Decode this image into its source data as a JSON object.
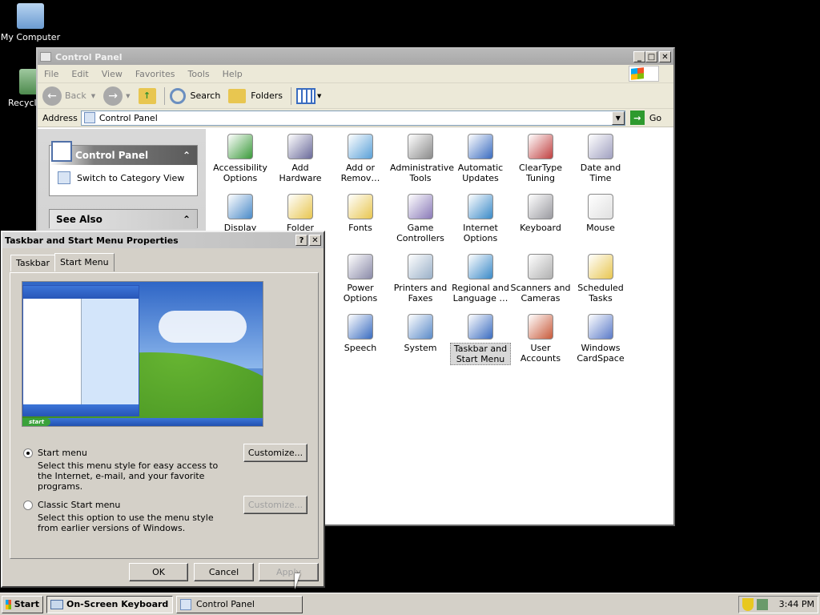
{
  "desktop": {
    "icons": [
      {
        "label": "My Computer",
        "icon": "computer-icon"
      },
      {
        "label": "Recycl",
        "icon": "recycle-bin-icon"
      }
    ]
  },
  "control_panel": {
    "title": "Control Panel",
    "menu": [
      "File",
      "Edit",
      "View",
      "Favorites",
      "Tools",
      "Help"
    ],
    "toolbar": {
      "back": "Back",
      "search": "Search",
      "folders": "Folders"
    },
    "address": {
      "label": "Address",
      "value": "Control Panel",
      "go": "Go"
    },
    "left_pane": {
      "box_title": "Control Panel",
      "switch_link": "Switch to Category View",
      "see_also": "See Also"
    },
    "items": [
      {
        "label": "Accessibility Options",
        "icon": "accessibility-icon"
      },
      {
        "label": "Add Hardware",
        "icon": "add-hardware-icon"
      },
      {
        "label": "Add or Remov…",
        "icon": "add-remove-programs-icon"
      },
      {
        "label": "Administrative Tools",
        "icon": "admin-tools-icon"
      },
      {
        "label": "Automatic Updates",
        "icon": "automatic-updates-icon"
      },
      {
        "label": "ClearType Tuning",
        "icon": "cleartype-icon"
      },
      {
        "label": "Date and Time",
        "icon": "date-time-icon"
      },
      {
        "label": "Display",
        "icon": "display-icon"
      },
      {
        "label": "Folder Options",
        "icon": "folder-options-icon"
      },
      {
        "label": "Fonts",
        "icon": "fonts-icon"
      },
      {
        "label": "Game Controllers",
        "icon": "game-controllers-icon"
      },
      {
        "label": "Internet Options",
        "icon": "internet-options-icon"
      },
      {
        "label": "Keyboard",
        "icon": "keyboard-icon"
      },
      {
        "label": "Mouse",
        "icon": "mouse-icon"
      },
      {
        "label": "Power Options",
        "icon": "power-options-icon"
      },
      {
        "label": "Printers and Faxes",
        "icon": "printers-icon"
      },
      {
        "label": "Regional and Language …",
        "icon": "regional-icon"
      },
      {
        "label": "Scanners and Cameras",
        "icon": "scanners-icon"
      },
      {
        "label": "Scheduled Tasks",
        "icon": "scheduled-tasks-icon"
      },
      {
        "label": "Speech",
        "icon": "speech-icon"
      },
      {
        "label": "System",
        "icon": "system-icon"
      },
      {
        "label": "Taskbar and Start Menu",
        "icon": "taskbar-icon"
      },
      {
        "label": "User Accounts",
        "icon": "user-accounts-icon"
      },
      {
        "label": "Windows CardSpace",
        "icon": "cardspace-icon"
      }
    ]
  },
  "dialog": {
    "title": "Taskbar and Start Menu Properties",
    "tabs": [
      "Taskbar",
      "Start Menu"
    ],
    "preview_start_label": "start",
    "options": [
      {
        "label": "Start menu",
        "desc": "Select this menu style for easy access to the Internet, e-mail, and your favorite programs.",
        "button": "Customize..."
      },
      {
        "label": "Classic Start menu",
        "desc": "Select this option to use the menu style from earlier versions of Windows.",
        "button": "Customize..."
      }
    ],
    "buttons": {
      "ok": "OK",
      "cancel": "Cancel",
      "apply": "Apply"
    }
  },
  "taskbar": {
    "start": "Start",
    "tasks": [
      "On-Screen Keyboard",
      "Control Panel"
    ],
    "clock": "3:44 PM"
  },
  "colors": {
    "desktop": "#000000",
    "face": "#d4d0c8",
    "sky": "#5d8fd5",
    "grass": "#3f8f22"
  }
}
